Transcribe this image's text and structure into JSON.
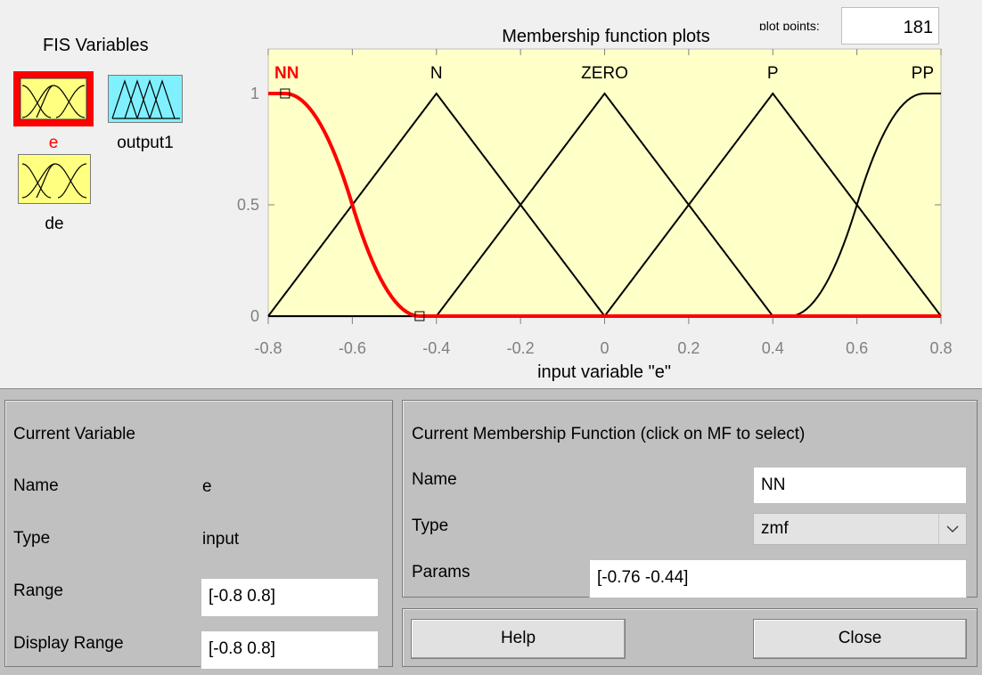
{
  "fis_variables": {
    "title": "FIS Variables",
    "inputs": [
      {
        "name": "e",
        "selected": true
      },
      {
        "name": "de",
        "selected": false
      }
    ],
    "outputs": [
      {
        "name": "output1",
        "selected": false
      }
    ]
  },
  "plot": {
    "title": "Membership function plots",
    "plot_points_label": "plot points:",
    "plot_points_value": "181",
    "xlabel": "input variable \"e\"",
    "colors": {
      "background": "#ffffc8",
      "selected": "#ff0000",
      "normal": "#000000",
      "axis": "#808080"
    }
  },
  "chart_data": {
    "type": "line",
    "title": "Membership function plots",
    "xlabel": "input variable \"e\"",
    "ylabel": "",
    "xlim": [
      -0.8,
      0.8
    ],
    "ylim": [
      0,
      1
    ],
    "xticks": [
      "-0.8",
      "-0.6",
      "-0.4",
      "-0.2",
      "0",
      "0.2",
      "0.4",
      "0.6",
      "0.8"
    ],
    "yticks": [
      "0",
      "0.5",
      "1"
    ],
    "series": [
      {
        "name": "NN",
        "mf": "zmf",
        "params": [
          -0.76,
          -0.44
        ],
        "selected": true
      },
      {
        "name": "N",
        "mf": "trimf",
        "params": [
          -0.8,
          -0.4,
          0
        ]
      },
      {
        "name": "ZERO",
        "mf": "trimf",
        "params": [
          -0.4,
          0,
          0.4
        ]
      },
      {
        "name": "P",
        "mf": "trimf",
        "params": [
          0,
          0.4,
          0.8
        ]
      },
      {
        "name": "PP",
        "mf": "smf",
        "params": [
          0.44,
          0.76
        ]
      }
    ]
  },
  "current_variable": {
    "title": "Current Variable",
    "name_label": "Name",
    "name_value": "e",
    "type_label": "Type",
    "type_value": "input",
    "range_label": "Range",
    "range_value": "[-0.8 0.8]",
    "display_range_label": "Display Range",
    "display_range_value": "[-0.8 0.8]"
  },
  "current_mf": {
    "title": "Current Membership Function (click on MF to select)",
    "name_label": "Name",
    "name_value": "NN",
    "type_label": "Type",
    "type_value": "zmf",
    "params_label": "Params",
    "params_value": "[-0.76 -0.44]"
  },
  "buttons": {
    "help": "Help",
    "close": "Close"
  }
}
